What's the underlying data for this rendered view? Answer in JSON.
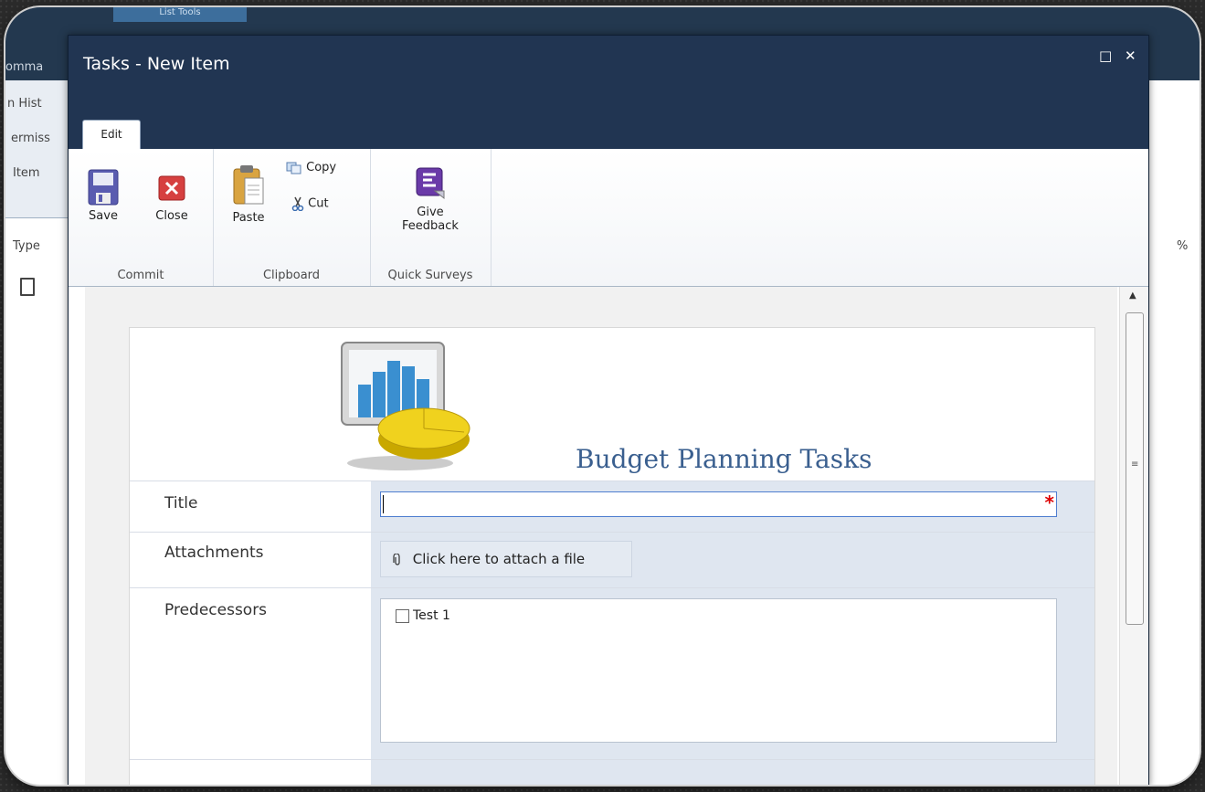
{
  "background_page": {
    "context_tab": "List Tools",
    "left_labels": [
      "omma",
      "n Hist",
      "ermiss",
      "Item"
    ],
    "column_label": "Type",
    "right_symbol": "%"
  },
  "dialog": {
    "title": "Tasks - New Item",
    "maximize_glyph": "□",
    "close_glyph": "✕"
  },
  "ribbon": {
    "tab": "Edit",
    "groups": {
      "commit": {
        "label": "Commit",
        "save": "Save",
        "close": "Close"
      },
      "clipboard": {
        "label": "Clipboard",
        "paste": "Paste",
        "copy": "Copy",
        "cut": "Cut"
      },
      "quick_surveys": {
        "label": "Quick Surveys",
        "give": "Give",
        "feedback": "Feedback"
      }
    }
  },
  "form": {
    "header": "Budget Planning Tasks",
    "fields": {
      "title": {
        "label": "Title",
        "value": "",
        "required_mark": "*"
      },
      "attachments": {
        "label": "Attachments",
        "button": "Click here to attach a file"
      },
      "predecessors": {
        "label": "Predecessors",
        "options": [
          "Test 1"
        ]
      }
    }
  },
  "icons": {
    "save": "floppy-disk-icon",
    "close": "red-x-icon",
    "paste": "clipboard-icon",
    "copy": "copy-icon",
    "cut": "scissors-icon",
    "feedback": "feedback-icon",
    "attach": "paperclip-icon",
    "logo": "chart-pie-logo"
  },
  "colors": {
    "titlebar": "#213552",
    "header_text": "#3a5f8f",
    "field_bg": "#dfe6f0",
    "required": "#dd0000"
  }
}
